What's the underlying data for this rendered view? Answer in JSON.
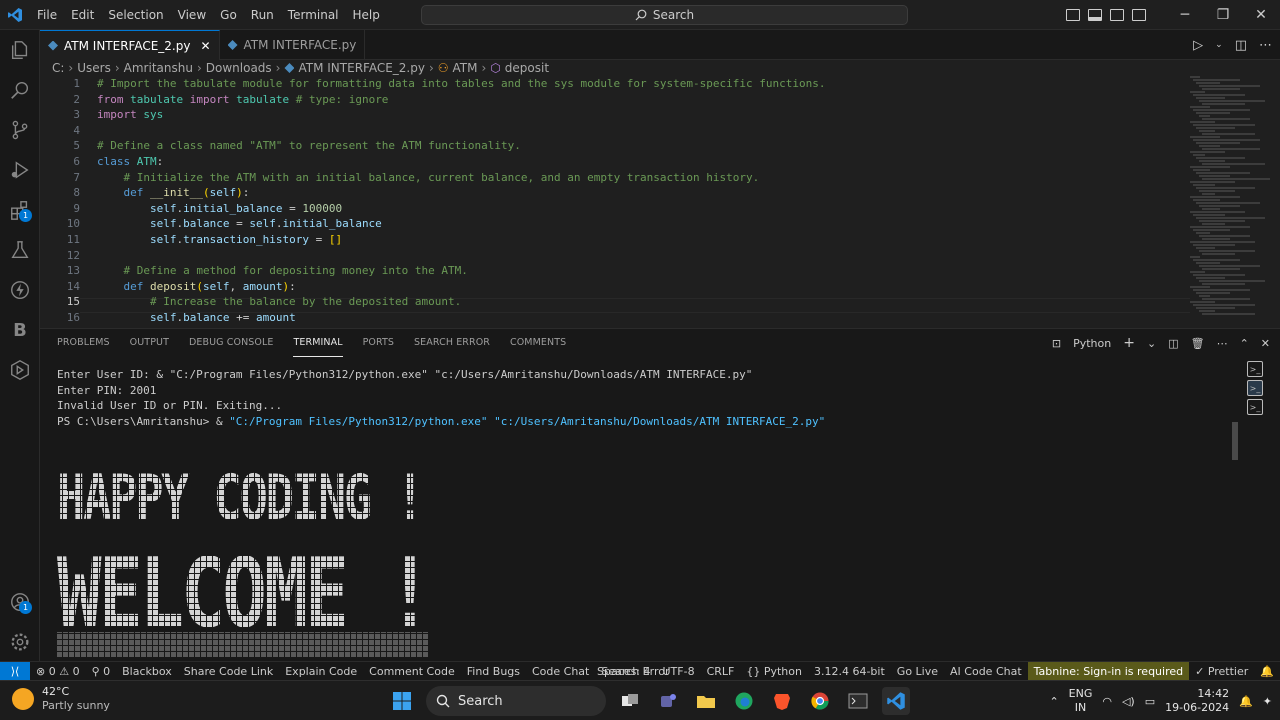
{
  "titlebar": {
    "menu": [
      "File",
      "Edit",
      "Selection",
      "View",
      "Go",
      "Run",
      "Terminal",
      "Help"
    ],
    "search_label": "Search"
  },
  "tabs": [
    {
      "label": "ATM INTERFACE_2.py",
      "active": true
    },
    {
      "label": "ATM INTERFACE.py",
      "active": false
    }
  ],
  "breadcrumb": [
    "C:",
    "Users",
    "Amritanshu",
    "Downloads",
    "ATM INTERFACE_2.py",
    "ATM",
    "deposit"
  ],
  "editor": {
    "line_numbers": [
      "1",
      "2",
      "3",
      "4",
      "5",
      "6",
      "7",
      "8",
      "9",
      "10",
      "11",
      "12",
      "13",
      "14",
      "15",
      "16"
    ],
    "current_line": "15",
    "lines": [
      "# Import the tabulate module for formatting data into tables and the sys module for system-specific functions.",
      "from tabulate import tabulate # type: ignore",
      "import sys",
      "",
      "# Define a class named \"ATM\" to represent the ATM functionality.",
      "class ATM:",
      "    # Initialize the ATM with an initial balance, current balance, and an empty transaction history.",
      "    def __init__(self):",
      "        self.initial_balance = 100000",
      "        self.balance = self.initial_balance",
      "        self.transaction_history = []",
      "",
      "    # Define a method for depositing money into the ATM.",
      "    def deposit(self, amount):",
      "        # Increase the balance by the deposited amount.",
      "        self.balance += amount"
    ]
  },
  "panel": {
    "tabs": [
      "PROBLEMS",
      "OUTPUT",
      "DEBUG CONSOLE",
      "TERMINAL",
      "PORTS",
      "SEARCH ERROR",
      "COMMENTS"
    ],
    "active_tab": "TERMINAL",
    "shell_label": "Python",
    "terminal_lines": [
      {
        "prefix": "Enter User ID: & ",
        "arg1": "\"C:/Program Files/Python312/python.exe\"",
        "mid": " ",
        "arg2": "\"c:/Users/Amritanshu/Downloads/ATM INTERFACE.py\""
      },
      {
        "prefix": "Enter PIN: 2001",
        "arg1": "",
        "mid": "",
        "arg2": ""
      },
      {
        "prefix": "Invalid User ID or PIN. Exiting...",
        "arg1": "",
        "mid": "",
        "arg2": ""
      },
      {
        "prefix": "PS C:\\Users\\Amritanshu> & ",
        "arg1": "\"C:/Program Files/Python312/python.exe\"",
        "mid": " ",
        "arg2": "\"c:/Users/Amritanshu/Downloads/ATM INTERFACE_2.py\""
      }
    ],
    "banner_line1": "HAPPY CODING !",
    "banner_line2": "WELCOME !"
  },
  "statusbar": {
    "left": [
      "⊗ 0 ⚠ 0",
      "⚲ 0",
      "Blackbox",
      "Share Code Link",
      "Explain Code",
      "Comment Code",
      "Find Bugs",
      "Code Chat",
      "Search Error"
    ],
    "right": [
      "Spaces: 4",
      "UTF-8",
      "CRLF",
      "{} Python",
      "3.12.4 64-bit",
      "Go Live",
      "AI Code Chat"
    ],
    "tabnine": "Tabnine: Sign-in is required",
    "prettier": "✓ Prettier"
  },
  "taskbar": {
    "temp": "42°C",
    "condition": "Partly sunny",
    "search_label": "Search",
    "lang": "ENG",
    "region": "IN",
    "time": "14:42",
    "date": "19-06-2024"
  },
  "colors": {
    "accent": "#0078d4",
    "comment": "#6a9955",
    "keyword": "#c586c0",
    "string": "#4fc1ff"
  }
}
